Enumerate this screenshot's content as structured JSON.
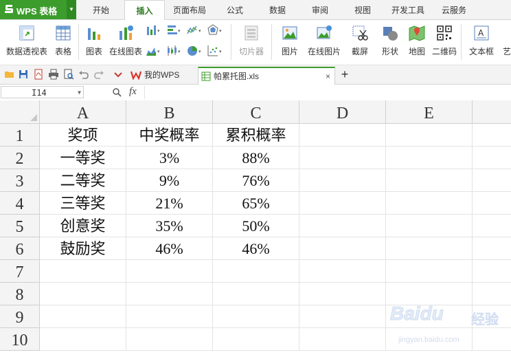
{
  "app": {
    "name": "WPS 表格",
    "menu_tabs": [
      "开始",
      "插入",
      "页面布局",
      "公式",
      "数据",
      "审阅",
      "视图",
      "开发工具",
      "云服务"
    ],
    "active_menu": "插入"
  },
  "ribbon": {
    "pivot_table": "数据透视表",
    "table": "表格",
    "chart": "图表",
    "online_chart": "在线图表",
    "slicer": "切片器",
    "picture": "图片",
    "online_picture": "在线图片",
    "screenshot": "截屏",
    "shapes": "形状",
    "map": "地图",
    "qrcode": "二维码",
    "textbox": "文本框",
    "more": "艺"
  },
  "tabs": {
    "home_tab": "我的WPS",
    "file_tab": "帕累托图.xls",
    "new_tab": "+",
    "close": "×"
  },
  "formula_bar": {
    "cell_ref": "I14",
    "fx": "fx",
    "formula": ""
  },
  "sheet": {
    "columns": [
      "A",
      "B",
      "C",
      "D",
      "E"
    ],
    "rows": [
      "1",
      "2",
      "3",
      "4",
      "5",
      "6",
      "7",
      "8",
      "9",
      "10"
    ],
    "cells": [
      [
        "奖项",
        "中奖概率",
        "累积概率"
      ],
      [
        "一等奖",
        "3%",
        "88%"
      ],
      [
        "二等奖",
        "9%",
        "76%"
      ],
      [
        "三等奖",
        "21%",
        "65%"
      ],
      [
        "创意奖",
        "35%",
        "50%"
      ],
      [
        "鼓励奖",
        "46%",
        "46%"
      ]
    ]
  },
  "watermark": {
    "brand": "Baidu",
    "sub": "经验",
    "url": "jingyan.baidu.com"
  },
  "colors": {
    "wps_green": "#3c9c2c",
    "ribbon_bg": "#ffffff",
    "header_bg": "#f4f4f4",
    "grid_line": "#e3e3e3"
  }
}
